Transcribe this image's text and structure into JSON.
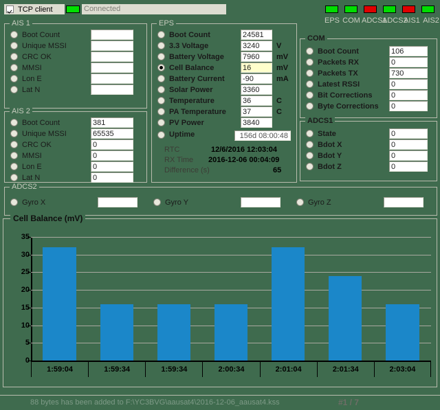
{
  "window": {
    "tcp_client_label": "TCP client",
    "tcp_client_checked": true,
    "connection_status": "Connected",
    "connection_led_color": "#00e000"
  },
  "status_leds": {
    "items": [
      {
        "label": "EPS",
        "color": "#00dd00"
      },
      {
        "label": "COM",
        "color": "#00dd00"
      },
      {
        "label": "ADCS1",
        "color": "#e00000"
      },
      {
        "label": "ADCS2",
        "color": "#00dd00"
      },
      {
        "label": "AIS1",
        "color": "#e00000"
      },
      {
        "label": "AIS2",
        "color": "#00dd00"
      }
    ]
  },
  "ais1": {
    "title": "AIS 1",
    "rows": [
      {
        "label": "Boot Count",
        "value": "",
        "selected": false
      },
      {
        "label": "Unique MSSI",
        "value": "",
        "selected": false
      },
      {
        "label": "CRC OK",
        "value": "",
        "selected": false
      },
      {
        "label": "MMSI",
        "value": "",
        "selected": false
      },
      {
        "label": "Lon E",
        "value": "",
        "selected": false
      },
      {
        "label": "Lat N",
        "value": "",
        "selected": false
      }
    ]
  },
  "ais2": {
    "title": "AIS 2",
    "rows": [
      {
        "label": "Boot Count",
        "value": "381",
        "selected": false
      },
      {
        "label": "Unique MSSI",
        "value": "65535",
        "selected": false
      },
      {
        "label": "CRC OK",
        "value": "0",
        "selected": false
      },
      {
        "label": "MMSI",
        "value": "0",
        "selected": false
      },
      {
        "label": "Lon E",
        "value": "0",
        "selected": false
      },
      {
        "label": "Lat N",
        "value": "0",
        "selected": false
      }
    ]
  },
  "eps": {
    "title": "EPS",
    "rows": [
      {
        "label": "Boot Count",
        "value": "24581",
        "unit": "",
        "selected": false
      },
      {
        "label": "3.3 Voltage",
        "value": "3240",
        "unit": "V",
        "selected": false
      },
      {
        "label": "Battery Voltage",
        "value": "7960",
        "unit": "mV",
        "selected": false
      },
      {
        "label": "Cell Balance",
        "value": "16",
        "unit": "mV",
        "selected": true
      },
      {
        "label": "Battery Current",
        "value": "-90",
        "unit": "mA",
        "selected": false
      },
      {
        "label": "Solar Power",
        "value": "3360",
        "unit": "",
        "selected": false
      },
      {
        "label": "Temperature",
        "value": "36",
        "unit": "C",
        "selected": false
      },
      {
        "label": "PA Temperature",
        "value": "37",
        "unit": "C",
        "selected": false
      },
      {
        "label": "PV Power",
        "value": "3840",
        "unit": "",
        "selected": false
      }
    ],
    "uptime_label": "Uptime",
    "uptime_value": "156d 08:00:48",
    "uptime_selected": false,
    "rtc_label": "RTC",
    "rtc_value": "12/6/2016 12:03:04",
    "rx_time_label": "RX Time",
    "rx_time_value": "2016-12-06 00:04:09",
    "difference_label": "Difference (s)",
    "difference_value": "65"
  },
  "com": {
    "title": "COM",
    "rows": [
      {
        "label": "Boot Count",
        "value": "106",
        "selected": false
      },
      {
        "label": "Packets RX",
        "value": "0",
        "selected": false
      },
      {
        "label": "Packets TX",
        "value": "730",
        "selected": false
      },
      {
        "label": "Latest RSSI",
        "value": "0",
        "selected": false
      },
      {
        "label": "Bit Corrections",
        "value": "0",
        "selected": false
      },
      {
        "label": "Byte Corrections",
        "value": "0",
        "selected": false
      }
    ]
  },
  "adcs1": {
    "title": "ADCS1",
    "rows": [
      {
        "label": "State",
        "value": "0",
        "selected": false
      },
      {
        "label": "Bdot X",
        "value": "0",
        "selected": false
      },
      {
        "label": "Bdot Y",
        "value": "0",
        "selected": false
      },
      {
        "label": "Bdot Z",
        "value": "0",
        "selected": false
      }
    ]
  },
  "adcs2": {
    "title": "ADCS2",
    "rows": [
      {
        "label": "Gyro X",
        "value": "",
        "selected": false
      },
      {
        "label": "Gyro Y",
        "value": "",
        "selected": false
      },
      {
        "label": "Gyro Z",
        "value": "",
        "selected": false
      }
    ]
  },
  "chart_data": {
    "type": "bar",
    "title": "Cell Balance (mV)",
    "xlabel": "",
    "ylabel": "",
    "categories": [
      "1:59:04",
      "1:59:34",
      "1:59:34",
      "2:00:34",
      "2:01:04",
      "2:01:34",
      "2:03:04"
    ],
    "values": [
      32,
      16,
      16,
      16,
      32,
      24,
      16
    ],
    "ylim": [
      0,
      35
    ],
    "yticks": [
      0,
      5,
      10,
      15,
      20,
      25,
      30,
      35
    ],
    "grid": true,
    "legend": false,
    "bar_color": "#1b87c9"
  },
  "statusbar": {
    "message": "88 bytes has been added to F:\\YC3BVG\\aausat4\\2016-12-06_aausat4.kss",
    "page": "#1 / 7"
  }
}
